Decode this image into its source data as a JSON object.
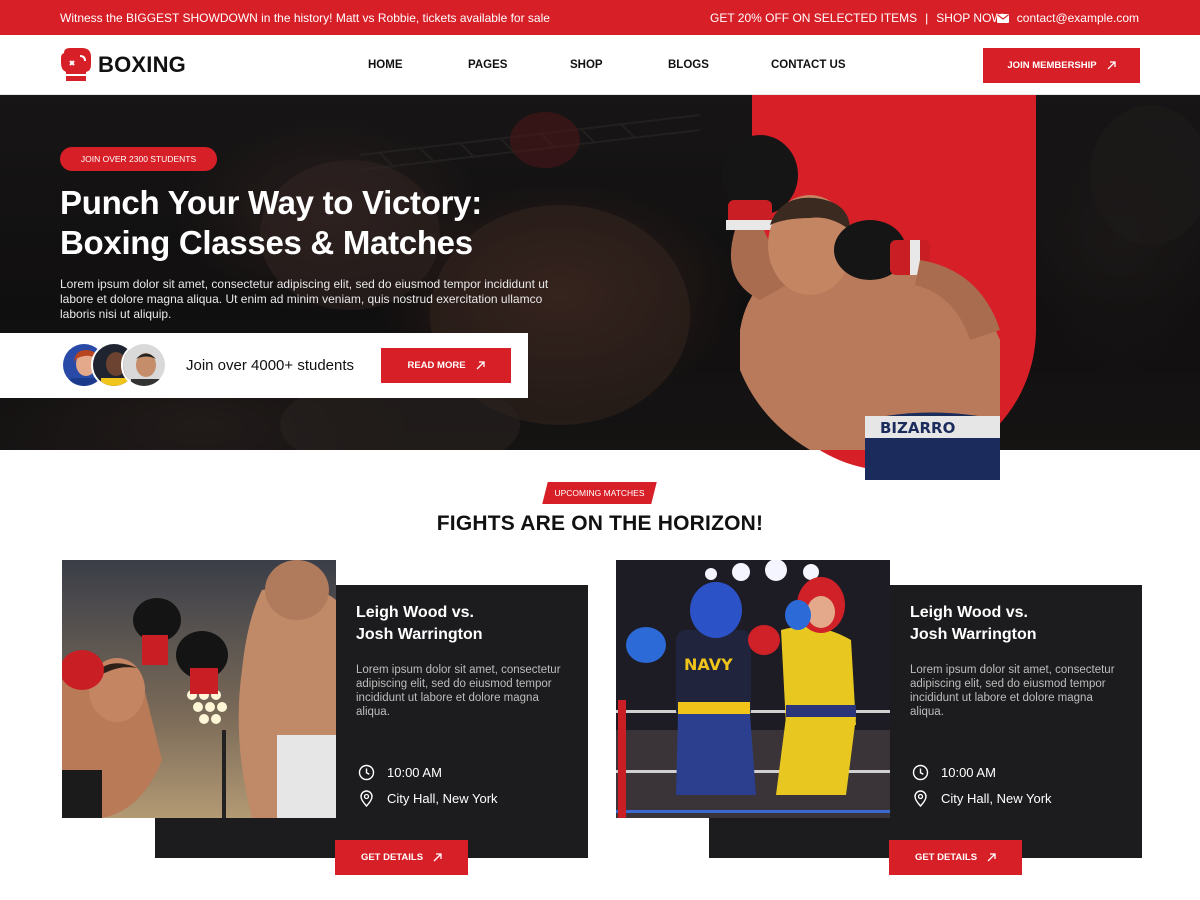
{
  "topbar": {
    "announcement": "Witness the BIGGEST SHOWDOWN in the history! Matt vs Robbie, tickets available for sale",
    "promo": "GET 20% OFF ON SELECTED ITEMS",
    "promo_separator": "|",
    "shop_now": "SHOP NOW",
    "email": "contact@example.com"
  },
  "header": {
    "logo_text": "BOXING",
    "nav": [
      "HOME",
      "PAGES",
      "SHOP",
      "BLOGS",
      "CONTACT US"
    ],
    "cta": "JOIN MEMBERSHIP"
  },
  "hero": {
    "badge": "JOIN OVER 2300 STUDENTS",
    "title": "Punch Your Way to Victory: Boxing Classes & Matches",
    "description": "Lorem ipsum dolor sit amet, consectetur adipiscing elit, sed do eiusmod tempor incididunt ut labore et dolore magna aliqua. Ut enim ad minim veniam, quis nostrud exercitation ullamco laboris nisi ut aliquip.",
    "join_text": "Join over 4000+ students",
    "read_more": "READ MORE",
    "shorts_text": "BIZARRO"
  },
  "section": {
    "tag": "UPCOMING MATCHES",
    "title": "FIGHTS ARE ON THE HORIZON!"
  },
  "matches": [
    {
      "title_line1": "Leigh Wood vs.",
      "title_line2": "Josh Warrington",
      "description": "Lorem ipsum dolor sit amet, consectetur adipiscing elit, sed do eiusmod tempor incididunt ut labore et dolore magna aliqua.",
      "time": "10:00 AM",
      "location": "City Hall, New York",
      "button": "GET DETAILS"
    },
    {
      "title_line1": "Leigh Wood vs.",
      "title_line2": "Josh Warrington",
      "description": "Lorem ipsum dolor sit amet, consectetur adipiscing elit, sed do eiusmod tempor incididunt ut labore et dolore magna aliqua.",
      "time": "10:00 AM",
      "location": "City Hall, New York",
      "button": "GET DETAILS",
      "jersey_text": "NAVY"
    }
  ],
  "colors": {
    "accent": "#d71f27",
    "dark": "#1c1c1e"
  }
}
